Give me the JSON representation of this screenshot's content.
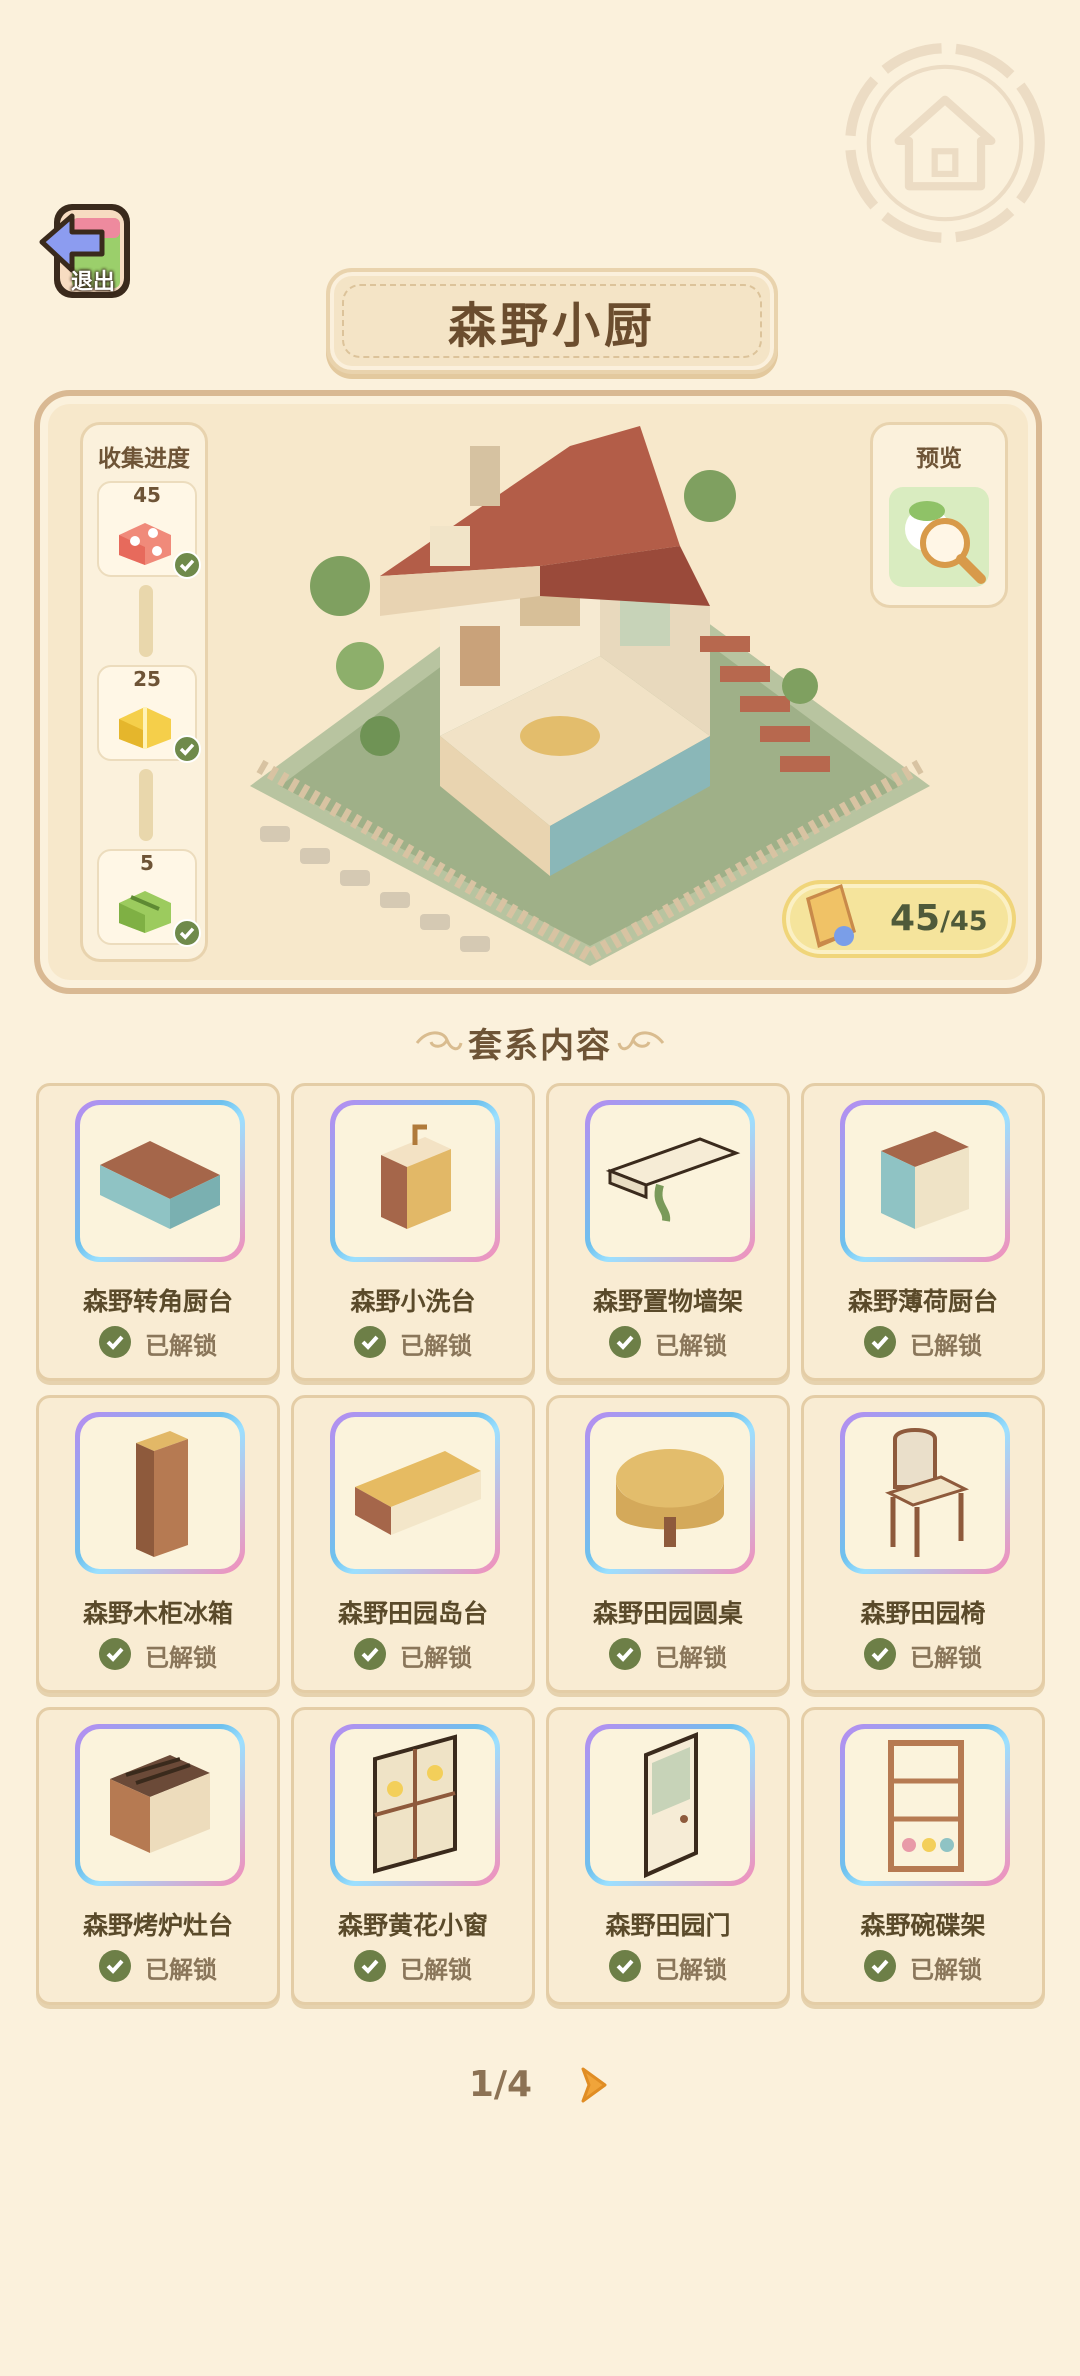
{
  "header": {
    "exit_label": "退出",
    "title": "森野小厨"
  },
  "progress": {
    "title": "收集进度",
    "tiers": [
      {
        "count": "45",
        "gift": "red-gift-icon",
        "claimed": true
      },
      {
        "count": "25",
        "gift": "yellow-gift-icon",
        "claimed": true
      },
      {
        "count": "5",
        "gift": "green-gift-icon",
        "claimed": true
      }
    ]
  },
  "preview": {
    "label": "预览"
  },
  "total": {
    "collected": "45",
    "denominator": "/45"
  },
  "section": {
    "title": "套系内容"
  },
  "items": [
    {
      "name": "森野转角厨台",
      "status": "已解锁",
      "icon": "corner-counter-icon"
    },
    {
      "name": "森野小洗台",
      "status": "已解锁",
      "icon": "small-sink-icon"
    },
    {
      "name": "森野置物墙架",
      "status": "已解锁",
      "icon": "wall-shelf-icon"
    },
    {
      "name": "森野薄荷厨台",
      "status": "已解锁",
      "icon": "mint-counter-icon"
    },
    {
      "name": "森野木柜冰箱",
      "status": "已解锁",
      "icon": "fridge-icon"
    },
    {
      "name": "森野田园岛台",
      "status": "已解锁",
      "icon": "island-counter-icon"
    },
    {
      "name": "森野田园圆桌",
      "status": "已解锁",
      "icon": "round-table-icon"
    },
    {
      "name": "森野田园椅",
      "status": "已解锁",
      "icon": "chair-icon"
    },
    {
      "name": "森野烤炉灶台",
      "status": "已解锁",
      "icon": "stove-icon"
    },
    {
      "name": "森野黄花小窗",
      "status": "已解锁",
      "icon": "window-icon"
    },
    {
      "name": "森野田园门",
      "status": "已解锁",
      "icon": "door-icon"
    },
    {
      "name": "森野碗碟架",
      "status": "已解锁",
      "icon": "dish-rack-icon"
    }
  ],
  "pager": {
    "indicator": "1/4"
  },
  "colors": {
    "background": "#fbf1dc",
    "accent_green": "#6d7f47",
    "text_brown": "#6e5436",
    "badge_yellow": "#f5e49c"
  }
}
